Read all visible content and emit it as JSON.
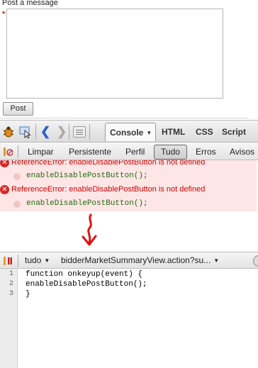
{
  "post_form": {
    "label": "Post a message",
    "required_marker": "*",
    "message_value": "",
    "post_button": "Post"
  },
  "firebug": {
    "toolbar": {
      "icons": [
        "firebug-bug-icon",
        "inspect-element-icon",
        "back-arrow-icon",
        "forward-arrow-icon",
        "command-list-icon"
      ],
      "active_tab": "Console",
      "tabs": [
        "HTML",
        "CSS",
        "Script"
      ]
    },
    "console_toolbar": {
      "clear": "Limpar",
      "persist": "Persistente",
      "profile": "Perfil",
      "all": "Tudo",
      "errors": "Erros",
      "warnings": "Avisos"
    },
    "log": [
      {
        "message": "ReferenceError: enableDisablePostButton is not defined",
        "source": "enableDisablePostButton();"
      },
      {
        "message": "ReferenceError: enableDisablePostButton is not defined",
        "source": "enableDisablePostButton();"
      }
    ],
    "script_toolbar": {
      "filter": "tudo",
      "file": "bidderMarketSummaryView.action?su..."
    },
    "script_source": {
      "line_numbers": [
        "1",
        "2",
        "3"
      ],
      "lines": [
        "function onkeyup(event) {",
        "enableDisablePostButton();",
        "}"
      ]
    }
  },
  "colors": {
    "error_text": "#d00000",
    "error_background": "#ffe6e6",
    "code_green": "#1c6b12",
    "annotation_red": "#e01010",
    "link_blue": "#2a61c9"
  }
}
